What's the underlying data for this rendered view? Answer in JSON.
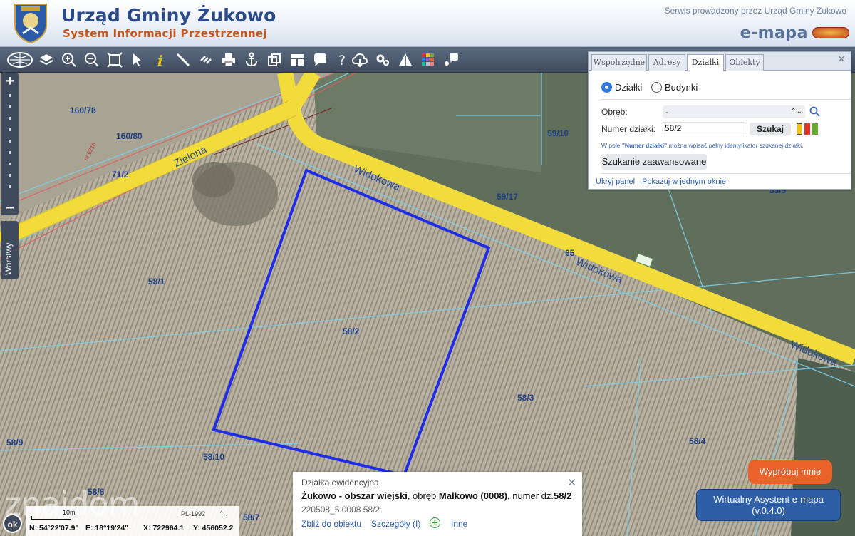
{
  "header": {
    "title": "Urząd Gminy Żukowo",
    "subtitle": "System Informacji Przestrzennej",
    "service_note": "Serwis prowadzony przez Urząd Gminy Żukowo",
    "emapa_logo": "e-mapa"
  },
  "toolbar": {
    "icons": [
      "world-map-icon",
      "layers-icon",
      "zoom-in-icon",
      "zoom-out-icon",
      "zoom-extent-icon",
      "pointer-icon",
      "info-icon",
      "measure-line-icon",
      "link-icon",
      "print-icon",
      "anchor-icon",
      "copy-icon",
      "layout-icon",
      "speech-icon",
      "help-icon",
      "cloud-icon",
      "settings-icon",
      "warning-icon",
      "color-grid-icon",
      "chat-icon"
    ]
  },
  "map": {
    "parcels": [
      "160/78",
      "160/80",
      "71/2",
      "59/10",
      "59/17",
      "65",
      "58/1",
      "58/2",
      "58/3",
      "58/4",
      "58/9",
      "58/10",
      "58/8",
      "58/7",
      "59/9"
    ],
    "streets": [
      "Zielona",
      "Widokowa",
      "Widokowa",
      "Widokowa"
    ],
    "road_codes": [
      "nr 6216",
      "65"
    ],
    "colors": {
      "road": "#f2dc3c",
      "selection": "#1f2ee6",
      "parcel_lines": "#7fd0e8"
    }
  },
  "side": {
    "zoom_in": "+",
    "zoom_out": "−",
    "layers_label": "Warstwy"
  },
  "panel": {
    "tabs": [
      "Współrzędne",
      "Adresy",
      "Działki",
      "Obiekty"
    ],
    "active_tab": "Działki",
    "radio_parcels": "Działki",
    "radio_buildings": "Budynki",
    "obreb_label": "Obręb:",
    "obreb_value": "-",
    "numer_label": "Numer działki:",
    "numer_value": "58/2",
    "search_button": "Szukaj",
    "hint_pre": "W pole ",
    "hint_bold": "\"Numer działki\"",
    "hint_post": " można wpisać pełny identyfikator szukanej działki.",
    "advanced_button": "Szukanie zaawansowane",
    "hide_link": "Ukryj panel",
    "show_window_link": "Pokazuj w jednym oknie",
    "swatch_colors": [
      "#f2c200",
      "#e8322a",
      "#6aa832"
    ]
  },
  "popup": {
    "title": "Działka ewidencyjna",
    "line_bold_1": "Żukowo - obszar wiejski",
    "line_text_1": ", obręb ",
    "line_bold_2": "Małkowo (0008)",
    "line_text_2": ", numer dz.",
    "line_bold_3": "58/2",
    "identifier": "220508_5.0008.58/2",
    "link_zoom": "Zbliż do obiektu",
    "link_details": "Szczegóły (I)",
    "link_other": "Inne"
  },
  "assistant": {
    "try_label": "Wypróbuj mnie",
    "line1": "Wirtualny Asystent e-mapa",
    "line2": "(v.0.4.0)"
  },
  "status": {
    "ok": "ok",
    "scale": "10m",
    "crs": "PL-1992",
    "n": "N: 54°22'07.9\"",
    "e": "E: 18°19'24\"",
    "x": "X: 722964.1",
    "y": "Y: 456052.2"
  },
  "watermark": "znajdom"
}
